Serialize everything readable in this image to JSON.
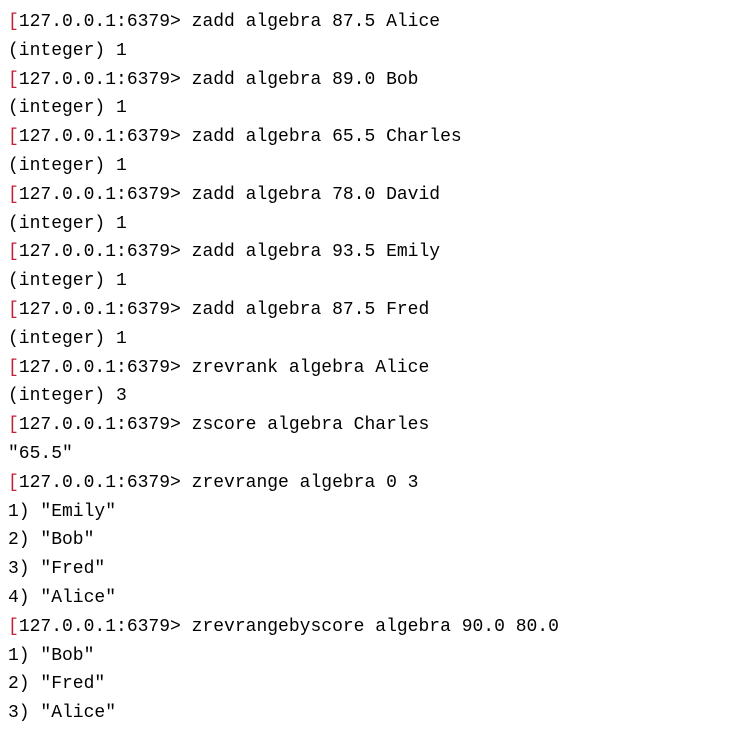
{
  "prompt": {
    "bracket": "[",
    "host": "127.0.0.1:6379>"
  },
  "lines": [
    {
      "type": "cmd",
      "text": "zadd algebra 87.5 Alice"
    },
    {
      "type": "out",
      "text": "(integer) 1"
    },
    {
      "type": "cmd",
      "text": "zadd algebra 89.0 Bob"
    },
    {
      "type": "out",
      "text": "(integer) 1"
    },
    {
      "type": "cmd",
      "text": "zadd algebra 65.5 Charles"
    },
    {
      "type": "out",
      "text": "(integer) 1"
    },
    {
      "type": "cmd",
      "text": "zadd algebra 78.0 David"
    },
    {
      "type": "out",
      "text": "(integer) 1"
    },
    {
      "type": "cmd",
      "text": "zadd algebra 93.5 Emily"
    },
    {
      "type": "out",
      "text": "(integer) 1"
    },
    {
      "type": "cmd",
      "text": "zadd algebra 87.5 Fred"
    },
    {
      "type": "out",
      "text": "(integer) 1"
    },
    {
      "type": "cmd",
      "text": "zrevrank algebra Alice"
    },
    {
      "type": "out",
      "text": "(integer) 3"
    },
    {
      "type": "cmd",
      "text": "zscore algebra Charles"
    },
    {
      "type": "out",
      "text": "\"65.5\""
    },
    {
      "type": "cmd",
      "text": "zrevrange algebra 0 3"
    },
    {
      "type": "out",
      "text": "1) \"Emily\""
    },
    {
      "type": "out",
      "text": "2) \"Bob\""
    },
    {
      "type": "out",
      "text": "3) \"Fred\""
    },
    {
      "type": "out",
      "text": "4) \"Alice\""
    },
    {
      "type": "cmd",
      "text": "zrevrangebyscore algebra 90.0 80.0"
    },
    {
      "type": "out",
      "text": "1) \"Bob\""
    },
    {
      "type": "out",
      "text": "2) \"Fred\""
    },
    {
      "type": "out",
      "text": "3) \"Alice\""
    }
  ]
}
